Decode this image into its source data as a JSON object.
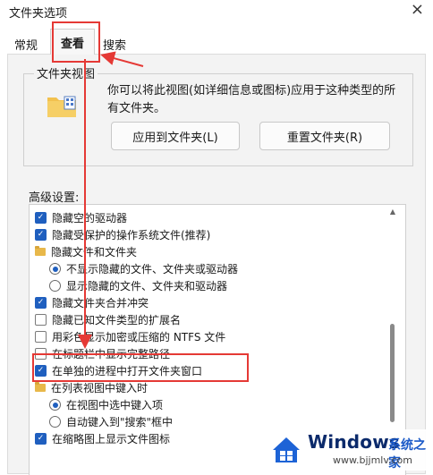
{
  "window": {
    "title": "文件夹选项",
    "close_glyph": "×"
  },
  "tabs": [
    {
      "label": "常规"
    },
    {
      "label": "查看"
    },
    {
      "label": "搜索"
    }
  ],
  "folder_views": {
    "group_label": "文件夹视图",
    "description": "你可以将此视图(如详细信息或图标)应用于这种类型的所有文件夹。",
    "apply_button": "应用到文件夹(L)",
    "reset_button": "重置文件夹(R)"
  },
  "advanced": {
    "label": "高级设置:",
    "items": [
      {
        "type": "checkbox",
        "checked": true,
        "indent": 0,
        "label": "隐藏空的驱动器"
      },
      {
        "type": "checkbox",
        "checked": true,
        "indent": 0,
        "label": "隐藏受保护的操作系统文件(推荐)"
      },
      {
        "type": "folder",
        "checked": null,
        "indent": 0,
        "label": "隐藏文件和文件夹"
      },
      {
        "type": "radio",
        "checked": true,
        "indent": 1,
        "label": "不显示隐藏的文件、文件夹或驱动器"
      },
      {
        "type": "radio",
        "checked": false,
        "indent": 1,
        "label": "显示隐藏的文件、文件夹和驱动器"
      },
      {
        "type": "checkbox",
        "checked": true,
        "indent": 0,
        "label": "隐藏文件夹合并冲突"
      },
      {
        "type": "checkbox",
        "checked": false,
        "indent": 0,
        "label": "隐藏已知文件类型的扩展名"
      },
      {
        "type": "checkbox",
        "checked": false,
        "indent": 0,
        "label": "用彩色显示加密或压缩的 NTFS 文件"
      },
      {
        "type": "checkbox",
        "checked": false,
        "indent": 0,
        "label": "在标题栏中显示完整路径"
      },
      {
        "type": "checkbox",
        "checked": true,
        "indent": 0,
        "label": "在单独的进程中打开文件夹窗口"
      },
      {
        "type": "folder",
        "checked": null,
        "indent": 0,
        "label": "在列表视图中键入时"
      },
      {
        "type": "radio",
        "checked": true,
        "indent": 1,
        "label": "在视图中选中键入项"
      },
      {
        "type": "radio",
        "checked": false,
        "indent": 1,
        "label": "自动键入到\"搜索\"框中"
      },
      {
        "type": "checkbox",
        "checked": true,
        "indent": 0,
        "label": "在缩略图上显示文件图标"
      }
    ]
  },
  "watermark": {
    "brand": "Windows",
    "subtitle": "系统之家",
    "url": "www.bjjmlv.com"
  },
  "colors": {
    "highlight": "#e53935",
    "checkbox_on": "#1f5fbf",
    "panel_bg": "#f3f3f3"
  }
}
